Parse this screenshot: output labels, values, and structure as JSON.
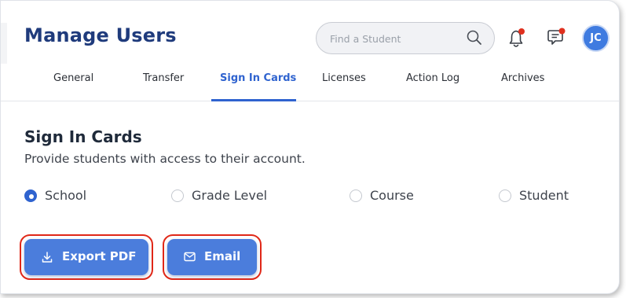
{
  "header": {
    "title": "Manage Users",
    "search": {
      "placeholder": "Find a Student",
      "value": ""
    },
    "avatar_initials": "JC",
    "notification_dot_color": "#e0301e"
  },
  "tabs": [
    {
      "label": "General",
      "active": false
    },
    {
      "label": "Transfer",
      "active": false
    },
    {
      "label": "Sign In Cards",
      "active": true
    },
    {
      "label": "Licenses",
      "active": false
    },
    {
      "label": "Action Log",
      "active": false
    },
    {
      "label": "Archives",
      "active": false
    }
  ],
  "section": {
    "title": "Sign In Cards",
    "subtitle": "Provide students with access to their account."
  },
  "options": [
    {
      "label": "School",
      "checked": true
    },
    {
      "label": "Grade Level",
      "checked": false
    },
    {
      "label": "Course",
      "checked": false
    },
    {
      "label": "Student",
      "checked": false
    }
  ],
  "actions": {
    "export_label": "Export PDF",
    "email_label": "Email"
  },
  "colors": {
    "brand_title": "#1f3b7c",
    "accent": "#2f63cf",
    "button": "#4b7ddc",
    "highlight_outline": "#e02818"
  },
  "icons": {
    "search": "search-icon",
    "notifications": "bell-icon",
    "messages": "chat-icon",
    "download": "download-icon",
    "email": "envelope-icon"
  }
}
